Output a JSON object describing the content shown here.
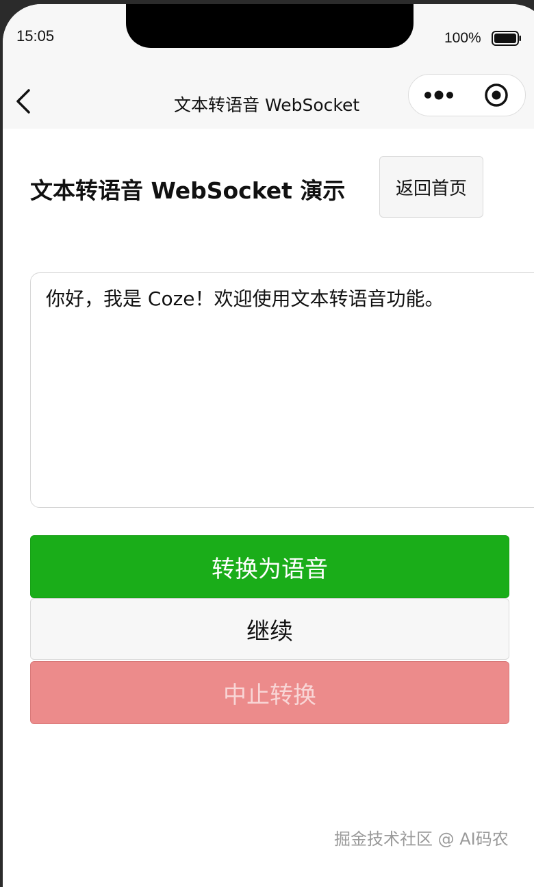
{
  "status_bar": {
    "time": "15:05",
    "battery_percent": "100%",
    "battery_icon": "battery-full-icon"
  },
  "nav_bar": {
    "title": "文本转语音 WebSocket",
    "back_icon": "chevron-left-icon",
    "more_icon": "more-dots-icon",
    "close_icon": "target-close-icon"
  },
  "main": {
    "heading": "文本转语音 WebSocket 演示",
    "home_button_label": "返回首页",
    "text_input_value": "你好，我是 Coze！欢迎使用文本转语音功能。",
    "convert_button_label": "转换为语音",
    "continue_button_label": "继续",
    "stop_button_label": "中止转换"
  },
  "watermark": "掘金技术社区 @ AI码农",
  "colors": {
    "primary_green": "#1aad19",
    "danger_red": "#ec8b8b",
    "nav_background": "#f7f7f7"
  }
}
